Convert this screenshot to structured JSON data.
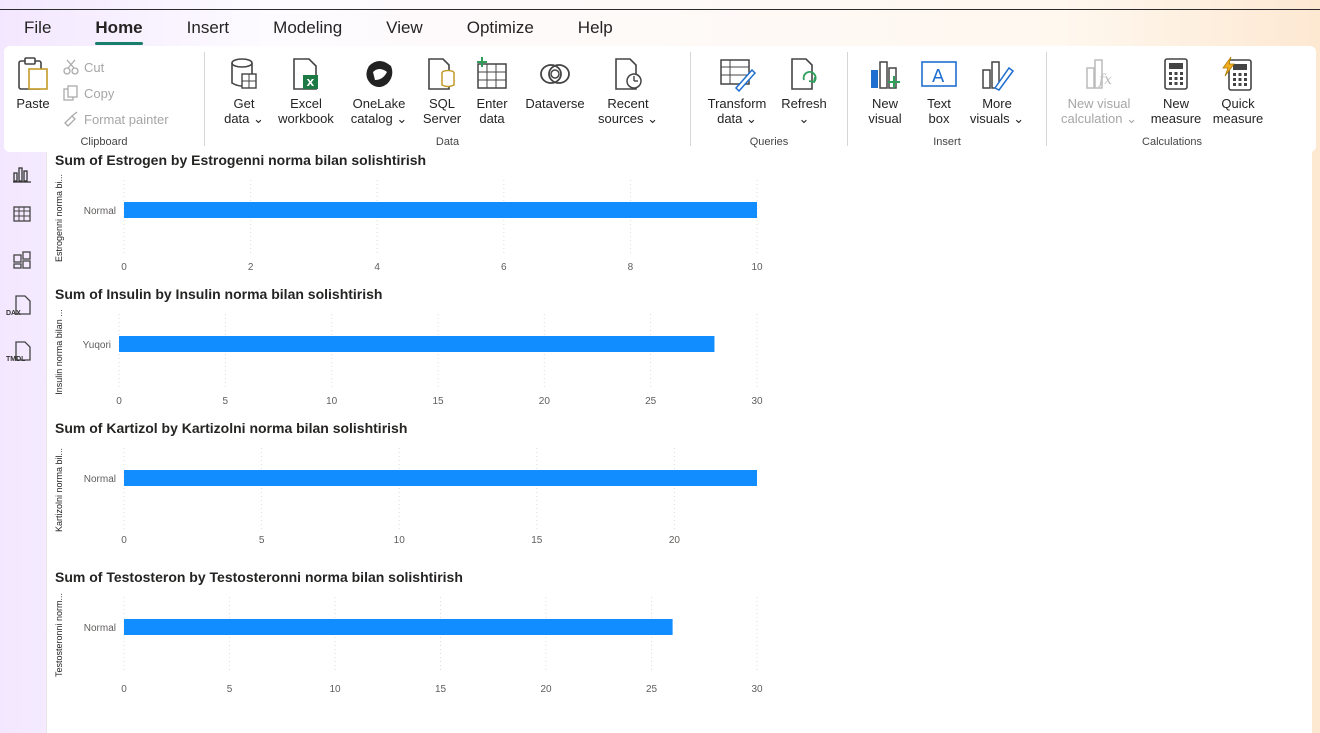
{
  "menu": {
    "tabs": [
      {
        "label": "File",
        "active": false
      },
      {
        "label": "Home",
        "active": true
      },
      {
        "label": "Insert",
        "active": false
      },
      {
        "label": "Modeling",
        "active": false
      },
      {
        "label": "View",
        "active": false
      },
      {
        "label": "Optimize",
        "active": false
      },
      {
        "label": "Help",
        "active": false
      }
    ]
  },
  "ribbon": {
    "clipboard": {
      "label": "Clipboard",
      "paste": "Paste",
      "cut": "Cut",
      "copy": "Copy",
      "format_painter": "Format painter"
    },
    "data": {
      "label": "Data",
      "get_data": [
        "Get",
        "data ⌄"
      ],
      "excel": [
        "Excel",
        "workbook"
      ],
      "onelake": [
        "OneLake",
        "catalog ⌄"
      ],
      "sql": [
        "SQL",
        "Server"
      ],
      "enter": [
        "Enter",
        "data"
      ],
      "dataverse": [
        "Dataverse",
        ""
      ],
      "recent": [
        "Recent",
        "sources ⌄"
      ]
    },
    "queries": {
      "label": "Queries",
      "transform": [
        "Transform",
        "data ⌄"
      ],
      "refresh": [
        "Refresh",
        "⌄"
      ]
    },
    "insert": {
      "label": "Insert",
      "new_visual": [
        "New",
        "visual"
      ],
      "text_box": [
        "Text",
        "box"
      ],
      "more_visuals": [
        "More",
        "visuals ⌄"
      ]
    },
    "calculations": {
      "label": "Calculations",
      "new_visual_calc": [
        "New visual",
        "calculation ⌄"
      ],
      "new_measure": [
        "New",
        "measure"
      ],
      "quick_measure": [
        "Quick",
        "measure"
      ]
    }
  },
  "rail": {
    "items": [
      "report-view",
      "table-view",
      "model-view",
      "dax-query-view",
      "tmdl-view"
    ],
    "dax_label": "DAX",
    "tmdl_label": "TMDL"
  },
  "colors": {
    "bar": "#118DFF",
    "accent": "#1a7f6a"
  },
  "chart_data": [
    {
      "type": "bar",
      "orientation": "horizontal",
      "title": "Sum of Estrogen by Estrogenni norma bilan solishtirish",
      "ylabel": "Estrogenni norma bi...",
      "categories": [
        "Normal"
      ],
      "values": [
        10
      ],
      "xlim": [
        0,
        10
      ],
      "ticks": [
        0,
        2,
        4,
        6,
        8,
        10
      ]
    },
    {
      "type": "bar",
      "orientation": "horizontal",
      "title": "Sum of Insulin by Insulin norma bilan solishtirish",
      "ylabel": "Insulin norma bilan ...",
      "categories": [
        "Yuqori"
      ],
      "values": [
        28
      ],
      "xlim": [
        0,
        30
      ],
      "ticks": [
        0,
        5,
        10,
        15,
        20,
        25,
        30
      ]
    },
    {
      "type": "bar",
      "orientation": "horizontal",
      "title": "Sum of Kartizol by Kartizolni norma bilan solishtirish",
      "ylabel": "Kartizolni norma bil...",
      "categories": [
        "Normal"
      ],
      "values": [
        23
      ],
      "xlim": [
        0,
        23
      ],
      "ticks": [
        0,
        5,
        10,
        15,
        20
      ]
    },
    {
      "type": "bar",
      "orientation": "horizontal",
      "title": "Sum of Testosteron by Testosteronni norma bilan solishtirish",
      "ylabel": "Testosteronni norm...",
      "categories": [
        "Normal"
      ],
      "values": [
        26
      ],
      "xlim": [
        0,
        30
      ],
      "ticks": [
        0,
        5,
        10,
        15,
        20,
        25,
        30
      ]
    }
  ]
}
